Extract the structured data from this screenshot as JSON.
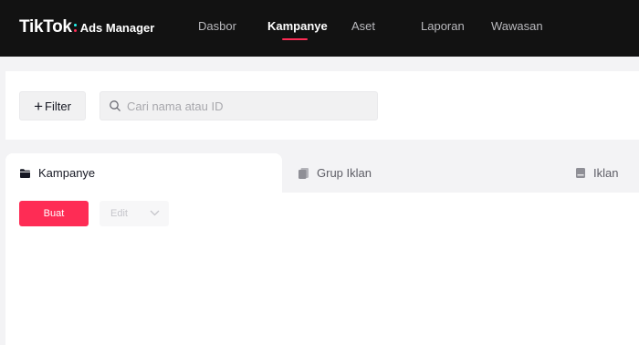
{
  "brand": {
    "wordmark": "TikTok",
    "product": "Ads Manager",
    "accent_color": "#fe2c55",
    "secondary_accent": "#25f4ee"
  },
  "nav": {
    "items": [
      {
        "label": "Dasbor",
        "active": false
      },
      {
        "label": "Kampanye",
        "active": true
      },
      {
        "label": "Aset",
        "active": false
      },
      {
        "label": "Laporan",
        "active": false
      },
      {
        "label": "Wawasan",
        "active": false
      }
    ]
  },
  "toolbar": {
    "filter_label": "Filter",
    "filter_icon": "plus-icon",
    "search_placeholder": "Cari nama atau ID",
    "search_value": "",
    "search_icon": "search-icon"
  },
  "tabs": [
    {
      "label": "Kampanye",
      "icon": "folder-icon",
      "active": true
    },
    {
      "label": "Grup Iklan",
      "icon": "ad-group-icon",
      "active": false
    },
    {
      "label": "Iklan",
      "icon": "ad-icon",
      "active": false
    }
  ],
  "actions": {
    "create_label": "Buat",
    "edit_label": "Edit",
    "edit_disabled": true
  }
}
